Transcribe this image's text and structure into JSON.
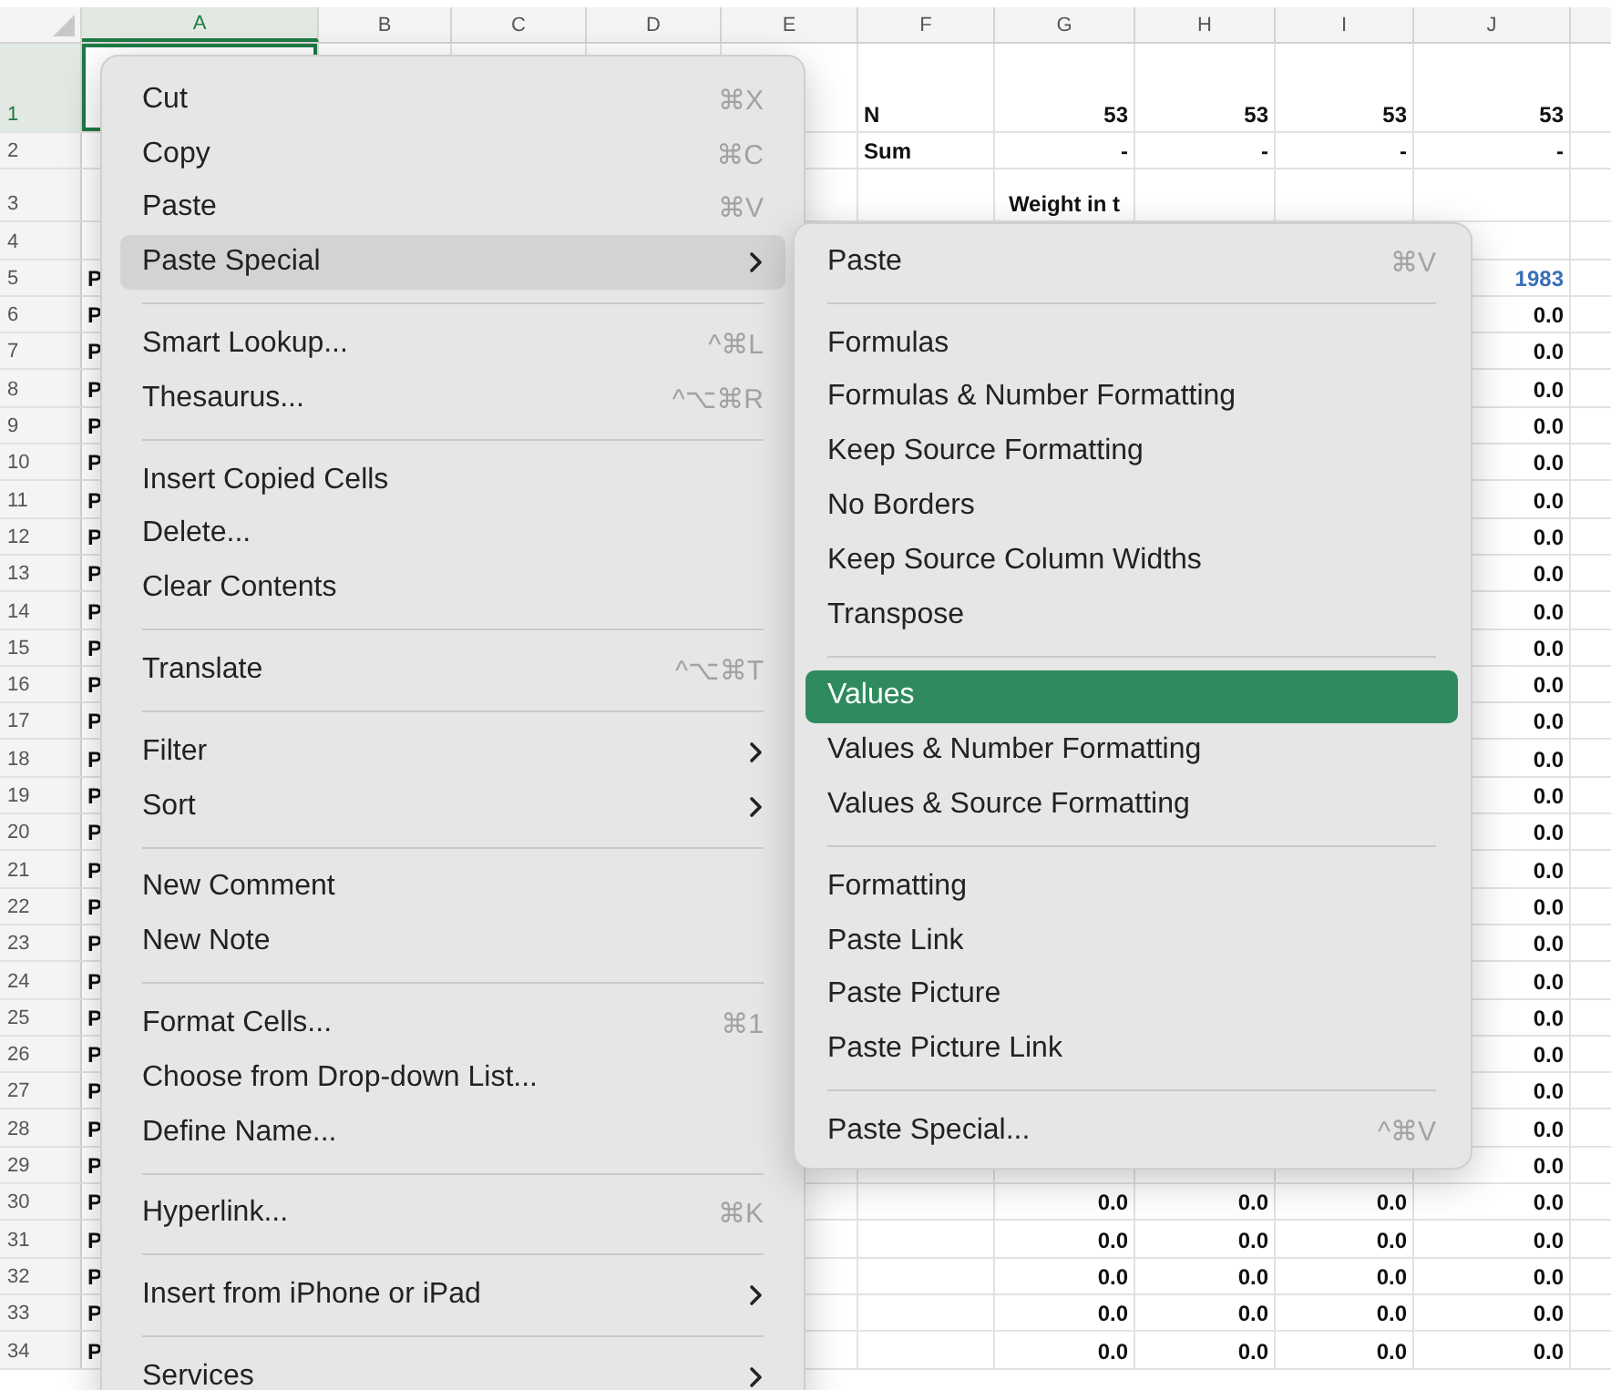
{
  "columns": [
    {
      "label": "A",
      "selected": true
    },
    {
      "label": "B",
      "selected": false
    },
    {
      "label": "C",
      "selected": false
    },
    {
      "label": "D",
      "selected": false
    },
    {
      "label": "E",
      "selected": false
    },
    {
      "label": "F",
      "selected": false
    },
    {
      "label": "G",
      "selected": false
    },
    {
      "label": "H",
      "selected": false
    },
    {
      "label": "I",
      "selected": false
    },
    {
      "label": "J",
      "selected": false
    }
  ],
  "rows": [
    {
      "number": "1",
      "selected": true,
      "kind": "title",
      "cells": {
        "col_6": "N",
        "col_7": "53",
        "col_8": "53",
        "col_9": "53",
        "col_10": "53"
      }
    },
    {
      "number": "2",
      "selected": false,
      "kind": "data",
      "cells": {
        "col_6": "Sum",
        "col_7": "-",
        "col_8": "-",
        "col_9": "-",
        "col_10": "-"
      }
    },
    {
      "number": "3",
      "selected": false,
      "kind": "heading",
      "cells": {
        "col_7": "Weight in t"
      }
    },
    {
      "number": "4",
      "selected": false,
      "kind": "data"
    },
    {
      "number": "5",
      "selected": false,
      "kind": "header",
      "cells": {
        "col_1": "P",
        "col_10": "1983"
      }
    },
    {
      "number": "6",
      "selected": false,
      "kind": "data",
      "cells": {
        "col_1": "P",
        "col_10": "0.0"
      }
    },
    {
      "number": "7",
      "selected": false,
      "kind": "data",
      "cells": {
        "col_1": "P",
        "col_10": "0.0"
      }
    },
    {
      "number": "8",
      "selected": false,
      "kind": "data",
      "cells": {
        "col_1": "P",
        "col_10": "0.0"
      }
    },
    {
      "number": "9",
      "selected": false,
      "kind": "data",
      "cells": {
        "col_1": "P",
        "col_10": "0.0"
      }
    },
    {
      "number": "10",
      "selected": false,
      "kind": "data",
      "cells": {
        "col_1": "P",
        "col_10": "0.0"
      }
    },
    {
      "number": "11",
      "selected": false,
      "kind": "data",
      "cells": {
        "col_1": "P",
        "col_10": "0.0"
      }
    },
    {
      "number": "12",
      "selected": false,
      "kind": "data",
      "cells": {
        "col_1": "P",
        "col_10": "0.0"
      }
    },
    {
      "number": "13",
      "selected": false,
      "kind": "data",
      "cells": {
        "col_1": "P",
        "col_10": "0.0"
      }
    },
    {
      "number": "14",
      "selected": false,
      "kind": "data",
      "cells": {
        "col_1": "P",
        "col_10": "0.0"
      }
    },
    {
      "number": "15",
      "selected": false,
      "kind": "data",
      "cells": {
        "col_1": "P",
        "col_10": "0.0"
      }
    },
    {
      "number": "16",
      "selected": false,
      "kind": "data",
      "cells": {
        "col_1": "P",
        "col_10": "0.0"
      }
    },
    {
      "number": "17",
      "selected": false,
      "kind": "data",
      "cells": {
        "col_1": "P",
        "col_10": "0.0"
      }
    },
    {
      "number": "18",
      "selected": false,
      "kind": "data",
      "cells": {
        "col_1": "P",
        "col_10": "0.0"
      }
    },
    {
      "number": "19",
      "selected": false,
      "kind": "data",
      "cells": {
        "col_1": "P",
        "col_10": "0.0"
      }
    },
    {
      "number": "20",
      "selected": false,
      "kind": "data",
      "cells": {
        "col_1": "P",
        "col_10": "0.0"
      }
    },
    {
      "number": "21",
      "selected": false,
      "kind": "data",
      "cells": {
        "col_1": "P",
        "col_10": "0.0"
      }
    },
    {
      "number": "22",
      "selected": false,
      "kind": "data",
      "cells": {
        "col_1": "P",
        "col_10": "0.0"
      }
    },
    {
      "number": "23",
      "selected": false,
      "kind": "data",
      "cells": {
        "col_1": "P",
        "col_10": "0.0"
      }
    },
    {
      "number": "24",
      "selected": false,
      "kind": "data",
      "cells": {
        "col_1": "P",
        "col_10": "0.0"
      }
    },
    {
      "number": "25",
      "selected": false,
      "kind": "data",
      "cells": {
        "col_1": "P",
        "col_10": "0.0"
      }
    },
    {
      "number": "26",
      "selected": false,
      "kind": "data",
      "cells": {
        "col_1": "P",
        "col_10": "0.0"
      }
    },
    {
      "number": "27",
      "selected": false,
      "kind": "data",
      "cells": {
        "col_1": "P",
        "col_10": "0.0"
      }
    },
    {
      "number": "28",
      "selected": false,
      "kind": "data",
      "cells": {
        "col_1": "P",
        "col_10": "0.0"
      }
    },
    {
      "number": "29",
      "selected": false,
      "kind": "data",
      "cells": {
        "col_1": "P",
        "col_10": "0.0"
      }
    },
    {
      "number": "30",
      "selected": false,
      "kind": "data",
      "cells": {
        "col_1": "P",
        "col_7": "0.0",
        "col_8": "0.0",
        "col_9": "0.0",
        "col_10": "0.0"
      }
    },
    {
      "number": "31",
      "selected": false,
      "kind": "data",
      "cells": {
        "col_1": "P",
        "col_7": "0.0",
        "col_8": "0.0",
        "col_9": "0.0",
        "col_10": "0.0"
      }
    },
    {
      "number": "32",
      "selected": false,
      "kind": "data",
      "cells": {
        "col_1": "P",
        "col_7": "0.0",
        "col_8": "0.0",
        "col_9": "0.0",
        "col_10": "0.0"
      }
    },
    {
      "number": "33",
      "selected": false,
      "kind": "data",
      "cells": {
        "col_1": "P",
        "col_7": "0.0",
        "col_8": "0.0",
        "col_9": "0.0",
        "col_10": "0.0"
      }
    },
    {
      "number": "34",
      "selected": false,
      "kind": "data",
      "cells": {
        "col_1": "P",
        "col_7": "0.0",
        "col_8": "0.0",
        "col_9": "0.0",
        "col_10": "0.0"
      }
    }
  ],
  "context_menu": [
    {
      "kind": "item",
      "label": "Cut",
      "shortcut": "⌘X",
      "open": false
    },
    {
      "kind": "item",
      "label": "Copy",
      "shortcut": "⌘C",
      "open": false
    },
    {
      "kind": "item",
      "label": "Paste",
      "shortcut": "⌘V",
      "open": false
    },
    {
      "kind": "submenu",
      "label": "Paste Special",
      "open": true
    },
    {
      "kind": "separator"
    },
    {
      "kind": "item",
      "label": "Smart Lookup...",
      "shortcut": "^⌘L",
      "open": false
    },
    {
      "kind": "item",
      "label": "Thesaurus...",
      "shortcut": "^⌥⌘R",
      "open": false
    },
    {
      "kind": "separator"
    },
    {
      "kind": "item",
      "label": "Insert Copied Cells",
      "open": false
    },
    {
      "kind": "item",
      "label": "Delete...",
      "open": false
    },
    {
      "kind": "item",
      "label": "Clear Contents",
      "open": false
    },
    {
      "kind": "separator"
    },
    {
      "kind": "item",
      "label": "Translate",
      "shortcut": "^⌥⌘T",
      "open": false
    },
    {
      "kind": "separator"
    },
    {
      "kind": "submenu",
      "label": "Filter",
      "open": false
    },
    {
      "kind": "submenu",
      "label": "Sort",
      "open": false
    },
    {
      "kind": "separator"
    },
    {
      "kind": "item",
      "label": "New Comment",
      "open": false
    },
    {
      "kind": "item",
      "label": "New Note",
      "open": false
    },
    {
      "kind": "separator"
    },
    {
      "kind": "item",
      "label": "Format Cells...",
      "shortcut": "⌘1",
      "open": false
    },
    {
      "kind": "item",
      "label": "Choose from Drop-down List...",
      "open": false
    },
    {
      "kind": "item",
      "label": "Define Name...",
      "open": false
    },
    {
      "kind": "separator"
    },
    {
      "kind": "item",
      "label": "Hyperlink...",
      "shortcut": "⌘K",
      "open": false
    },
    {
      "kind": "separator"
    },
    {
      "kind": "submenu",
      "label": "Insert from iPhone or iPad",
      "open": false
    },
    {
      "kind": "separator"
    },
    {
      "kind": "submenu",
      "label": "Services",
      "open": false
    }
  ],
  "paste_special_menu": [
    {
      "kind": "item",
      "label": "Paste",
      "shortcut": "⌘V",
      "selected": false
    },
    {
      "kind": "separator"
    },
    {
      "kind": "item",
      "label": "Formulas",
      "selected": false
    },
    {
      "kind": "item",
      "label": "Formulas & Number Formatting",
      "selected": false
    },
    {
      "kind": "item",
      "label": "Keep Source Formatting",
      "selected": false
    },
    {
      "kind": "item",
      "label": "No Borders",
      "selected": false
    },
    {
      "kind": "item",
      "label": "Keep Source Column Widths",
      "selected": false
    },
    {
      "kind": "item",
      "label": "Transpose",
      "selected": false
    },
    {
      "kind": "separator"
    },
    {
      "kind": "item",
      "label": "Values",
      "selected": true
    },
    {
      "kind": "item",
      "label": "Values & Number Formatting",
      "selected": false
    },
    {
      "kind": "item",
      "label": "Values & Source Formatting",
      "selected": false
    },
    {
      "kind": "separator"
    },
    {
      "kind": "item",
      "label": "Formatting",
      "selected": false
    },
    {
      "kind": "item",
      "label": "Paste Link",
      "selected": false
    },
    {
      "kind": "item",
      "label": "Paste Picture",
      "selected": false
    },
    {
      "kind": "item",
      "label": "Paste Picture Link",
      "selected": false
    },
    {
      "kind": "separator"
    },
    {
      "kind": "item",
      "label": "Paste Special...",
      "shortcut": "^⌘V",
      "selected": false
    }
  ]
}
